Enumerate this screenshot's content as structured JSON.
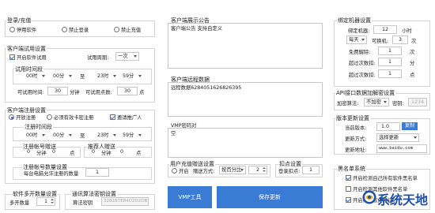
{
  "login": {
    "title": "登录/充值",
    "options": [
      "停用软件",
      "禁止登录",
      "禁止充值"
    ]
  },
  "trial": {
    "title": "客户端试用设置",
    "enable_label": "开启软件试用",
    "period_label": "试用周期:",
    "period_value": "一次",
    "range_title": "试用时间段",
    "start_hour": "00时",
    "start_min": "00分",
    "to": "至",
    "end_hour": "23时",
    "end_min": "59分",
    "duration_label": "可试用时间:",
    "duration_value": "30",
    "duration_unit": "分钟",
    "points_label": "可试用点数:",
    "points_value": "30",
    "points_unit": "点"
  },
  "register": {
    "title": "客户端注册设置",
    "options": [
      "开放注册",
      "必须有效卡密注册",
      "邀请推广人"
    ],
    "range_title": "注册时间段",
    "start_hour": "00时",
    "start_min": "00分",
    "to": "至",
    "end_hour": "23时",
    "end_min": "59分",
    "reward_title": "注册帐号赠送",
    "reward_value": "0",
    "reward_unit1": "分钟",
    "reward_points": "0",
    "reward_unit2": "点",
    "invite_title": "推荐人赠送",
    "invite_value": "0",
    "invite_unit1": "分钟",
    "invite_points": "0",
    "invite_unit2": "点",
    "limit_title": "注册帐号数量设置",
    "limit_label": "每台电脑允许注册的数量",
    "limit_value": "1"
  },
  "multi": {
    "title": "软件多开数量设置",
    "label": "多开数量",
    "value": "1"
  },
  "comm": {
    "title": "通讯算法密钥设置",
    "label": "算法密钥",
    "value": "3281B7E84D2D2DB..."
  },
  "notice": {
    "title": "客户端展示公告",
    "content": "客户端公告 支持自定义"
  },
  "remote": {
    "title": "客户端远程数据",
    "content": "远程数据6284051626826395"
  },
  "vmp": {
    "title": "VMP密码对",
    "content": "空"
  },
  "recharge": {
    "title": "用户充值赠送设置",
    "enable_label": "开启",
    "method_label": "赠送方式:",
    "method_value": "按百分比",
    "value": "2"
  },
  "deduct": {
    "title": "扣点设置",
    "label": "登录扣点:",
    "value": "1"
  },
  "buttons": {
    "vmp_tool": "VMP工具",
    "save": "保存更新"
  },
  "bind": {
    "title": "绑定机器设置",
    "bind_label": "绑定机器:",
    "bind_value": "12",
    "bind_unit": "小时",
    "period_value": "每天",
    "rebind_label": "可换机:",
    "rebind_value": "3",
    "rebind_unit": "次",
    "free_label": "免费解除:",
    "free_value": "1",
    "free_unit": "次",
    "over_time_label": "超过次数扣:",
    "over_time_value": "1",
    "over_time_unit": "分",
    "over_point_label": "超过次数扣:",
    "over_point_value": "1",
    "over_point_unit": "点"
  },
  "api": {
    "title": "API接口数据加解密设置",
    "algo_label": "加密算法:",
    "algo_value": "不加密",
    "key_label": "密钥:",
    "key_value": "1234"
  },
  "version": {
    "title": "版本更新设置",
    "current_label": "当前版本:",
    "current_value": "1.0",
    "copy_button": "复制",
    "method_label": "更新方式:",
    "method_value": "选择更新",
    "url_label": "更新地址:",
    "url_value": "www.baidu.com"
  },
  "blacklist": {
    "title": "黑名单系统",
    "items": [
      "开启检测自己所有软件黑名单",
      "开启检测其他软件黑名单",
      "开启检测软件特征"
    ]
  },
  "watermark": {
    "text": "系统天地"
  }
}
